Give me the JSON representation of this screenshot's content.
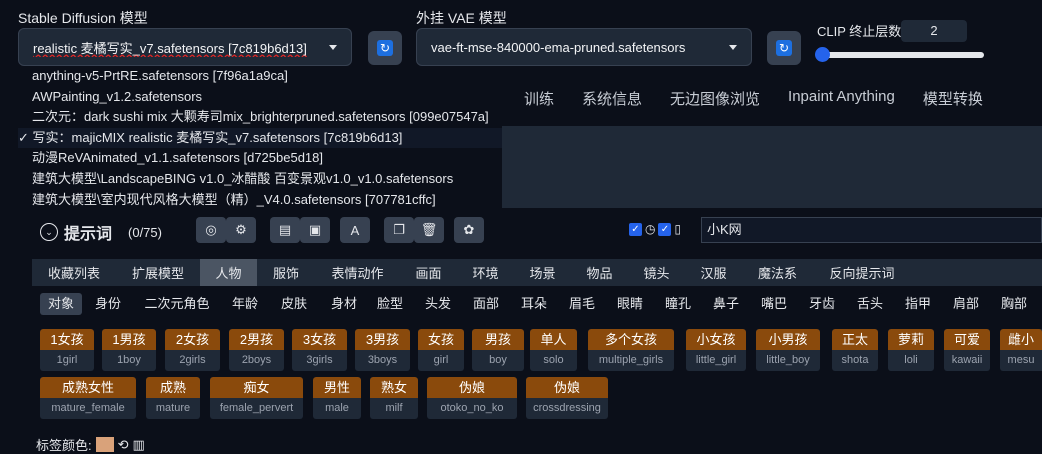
{
  "model": {
    "label": "Stable Diffusion 模型",
    "value": "realistic 麦橘写实_v7.safetensors [7c819b6d13]"
  },
  "vae": {
    "label": "外挂 VAE 模型",
    "value": "vae-ft-mse-840000-ema-pruned.safetensors"
  },
  "clip": {
    "label": "CLIP 终止层数",
    "value": "2",
    "slider_fraction": 0.0
  },
  "model_menu": [
    "anything-v5-PrtRE.safetensors [7f96a1a9ca]",
    "AWPainting_v1.2.safetensors",
    "二次元：dark sushi mix 大颗寿司mix_brighterpruned.safetensors [099e07547a]",
    "✓ 写实：majicMIX realistic 麦橘写实_v7.safetensors [7c819b6d13]",
    "动漫ReVAnimated_v1.1.safetensors [d725be5d18]",
    "建筑大模型\\LandscapeBING v1.0_冰醋酸 百变景观v1.0_v1.0.safetensors",
    "建筑大模型\\室内现代风格大模型（精）_V4.0.safetensors [707781cffc]"
  ],
  "top_tabs": [
    "训练",
    "系统信息",
    "无边图像浏览",
    "Inpaint Anything",
    "模型转换"
  ],
  "prompt": {
    "title": "提示词",
    "count": "(0/75)",
    "chevron": "chevron-down-icon",
    "search_value": "小K网"
  },
  "categories": [
    "收藏列表",
    "扩展模型",
    "人物",
    "服饰",
    "表情动作",
    "画面",
    "环境",
    "场景",
    "物品",
    "镜头",
    "汉服",
    "魔法系",
    "反向提示词"
  ],
  "subcategories": [
    "对象",
    "身份",
    "二次元角色",
    "年龄",
    "皮肤",
    "身材",
    "脸型",
    "头发",
    "面部",
    "耳朵",
    "眉毛",
    "眼睛",
    "瞳孔",
    "鼻子",
    "嘴巴",
    "牙齿",
    "舌头",
    "指甲",
    "肩部",
    "胸部"
  ],
  "tags_row1": [
    {
      "cn": "1女孩",
      "en": "1girl"
    },
    {
      "cn": "1男孩",
      "en": "1boy"
    },
    {
      "cn": "2女孩",
      "en": "2girls"
    },
    {
      "cn": "2男孩",
      "en": "2boys"
    },
    {
      "cn": "3女孩",
      "en": "3girls"
    },
    {
      "cn": "3男孩",
      "en": "3boys"
    },
    {
      "cn": "女孩",
      "en": "girl"
    },
    {
      "cn": "男孩",
      "en": "boy"
    },
    {
      "cn": "单人",
      "en": "solo"
    },
    {
      "cn": "多个女孩",
      "en": "multiple_girls"
    },
    {
      "cn": "小女孩",
      "en": "little_girl"
    },
    {
      "cn": "小男孩",
      "en": "little_boy"
    },
    {
      "cn": "正太",
      "en": "shota"
    },
    {
      "cn": "萝莉",
      "en": "loli"
    },
    {
      "cn": "可爱",
      "en": "kawaii"
    },
    {
      "cn": "雌小",
      "en": "mesu"
    }
  ],
  "tags_row2": [
    {
      "cn": "成熟女性",
      "en": "mature_female"
    },
    {
      "cn": "成熟",
      "en": "mature"
    },
    {
      "cn": "痴女",
      "en": "female_pervert"
    },
    {
      "cn": "男性",
      "en": "male"
    },
    {
      "cn": "熟女",
      "en": "milf"
    },
    {
      "cn": "伪娘",
      "en": "otoko_no_ko"
    },
    {
      "cn": "伪娘",
      "en": "crossdressing"
    }
  ],
  "tag_color_label": "标签颜色:",
  "colors": {
    "bg": "#0b0f19",
    "panel": "#1f2937",
    "tag_header": "#8a4a0c",
    "accent": "#2563eb"
  }
}
